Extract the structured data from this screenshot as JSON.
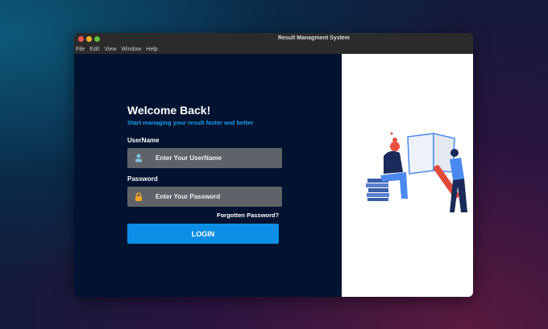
{
  "window": {
    "title": "Result Managment System"
  },
  "menu": [
    "File",
    "Edit",
    "View",
    "Window",
    "Help"
  ],
  "login": {
    "heading": "Welcome Back!",
    "subtitle": "Start managing your result faster and better",
    "username_label": "UserName",
    "username_placeholder": "Enter Your UserName",
    "password_label": "Password",
    "password_placeholder": "Enter Your Password",
    "forgot": "Forgotten Password?",
    "button": "LOGIN"
  },
  "colors": {
    "accent": "#0a8ee6",
    "panel": "#011330"
  }
}
